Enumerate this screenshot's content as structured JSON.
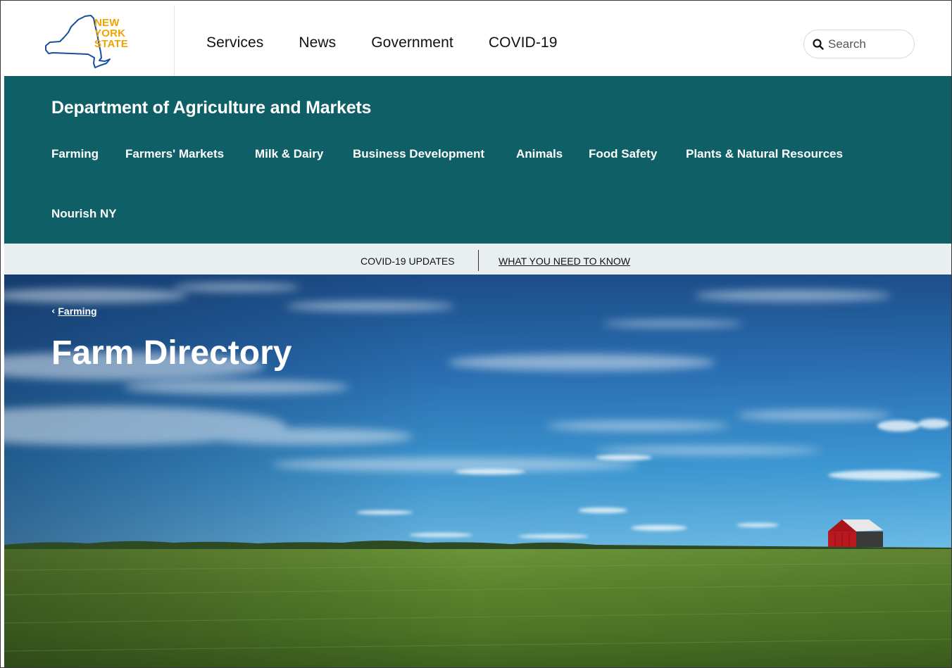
{
  "global_header": {
    "logo_lines": [
      "NEW",
      "YORK",
      "STATE"
    ],
    "nav": [
      {
        "label": "Services"
      },
      {
        "label": "News"
      },
      {
        "label": "Government"
      },
      {
        "label": "COVID-19"
      }
    ],
    "search": {
      "placeholder": "Search",
      "icon": "search-icon"
    }
  },
  "agency": {
    "title": "Department of Agriculture and Markets",
    "nav": [
      {
        "label": "Farming"
      },
      {
        "label": "Farmers' Markets"
      },
      {
        "label": "Milk & Dairy"
      },
      {
        "label": "Business Development"
      },
      {
        "label": "Animals"
      },
      {
        "label": "Food Safety"
      },
      {
        "label": "Plants & Natural Resources"
      },
      {
        "label": "Nourish NY"
      }
    ]
  },
  "covid_banner": {
    "label": "COVID-19 UPDATES",
    "link": "WHAT YOU NEED TO KNOW"
  },
  "hero": {
    "breadcrumb": "Farming",
    "title": "Farm Directory"
  },
  "colors": {
    "agency_teal": "#0f5f66",
    "logo_gold": "#f2a300",
    "logo_blue": "#1a4d9c",
    "banner_bg": "#e9eff1"
  }
}
